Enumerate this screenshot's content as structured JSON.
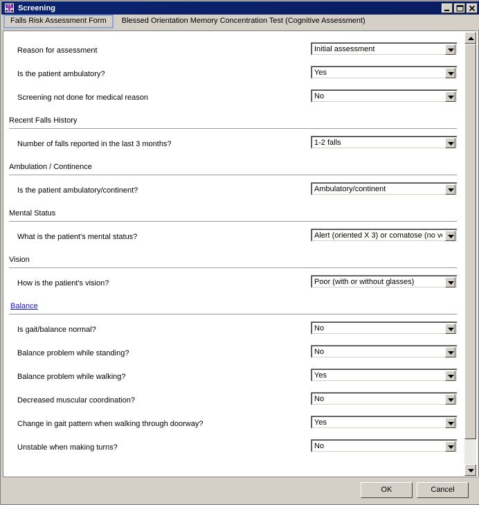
{
  "window": {
    "title": "Screening",
    "icon": "app-icon",
    "controls": [
      {
        "name": "minimize-button",
        "icon": "minimize-icon"
      },
      {
        "name": "maximize-button",
        "icon": "maximize-icon"
      },
      {
        "name": "close-button",
        "icon": "close-icon"
      }
    ]
  },
  "tabs": [
    {
      "label": "Falls Risk Assessment Form",
      "active": true
    },
    {
      "label": "Blessed Orientation Memory Concentration Test (Cognitive Assessment)",
      "active": false
    }
  ],
  "form": {
    "rows": [
      {
        "type": "field",
        "label": "Reason for assessment",
        "value": "Initial assessment",
        "name": "reason-for-assessment"
      },
      {
        "type": "field",
        "label": "Is the patient ambulatory?",
        "value": "Yes",
        "name": "is-patient-ambulatory"
      },
      {
        "type": "field",
        "label": "Screening not done for medical reason",
        "value": "No",
        "name": "screening-not-done-medical-reason"
      },
      {
        "type": "section",
        "label": "Recent Falls History",
        "link": false,
        "name": "section-recent-falls-history"
      },
      {
        "type": "field",
        "label": "Number of falls reported in the last 3 months?",
        "value": "1-2 falls",
        "name": "number-of-falls-last-3-months"
      },
      {
        "type": "section",
        "label": "Ambulation / Continence",
        "link": false,
        "name": "section-ambulation-continence"
      },
      {
        "type": "field",
        "label": "Is the patient ambulatory/continent?",
        "value": "Ambulatory/continent",
        "name": "is-patient-ambulatory-continent"
      },
      {
        "type": "section",
        "label": "Mental Status",
        "link": false,
        "name": "section-mental-status"
      },
      {
        "type": "field",
        "label": "What is the patient's mental status?",
        "value": "Alert (oriented X 3) or comatose (no volu",
        "name": "patient-mental-status"
      },
      {
        "type": "section",
        "label": "Vision",
        "link": false,
        "name": "section-vision"
      },
      {
        "type": "field",
        "label": "How is the patient's vision?",
        "value": "Poor (with or without glasses)",
        "name": "patient-vision"
      },
      {
        "type": "section",
        "label": "Balance",
        "link": true,
        "name": "section-balance"
      },
      {
        "type": "field",
        "label": "Is gait/balance normal?",
        "value": "No",
        "name": "is-gait-balance-normal"
      },
      {
        "type": "field",
        "label": "Balance problem while standing?",
        "value": "No",
        "name": "balance-problem-standing"
      },
      {
        "type": "field",
        "label": "Balance problem while walking?",
        "value": "Yes",
        "name": "balance-problem-walking"
      },
      {
        "type": "field",
        "label": "Decreased muscular coordination?",
        "value": "No",
        "name": "decreased-muscular-coordination"
      },
      {
        "type": "field",
        "label": "Change in gait pattern when walking through doorway?",
        "value": "Yes",
        "name": "change-gait-pattern-doorway"
      },
      {
        "type": "field",
        "label": "Unstable when making turns?",
        "value": "No",
        "name": "unstable-making-turns"
      }
    ]
  },
  "buttons": {
    "ok": "OK",
    "cancel": "Cancel"
  },
  "colors": {
    "titlebar": "#0a1f6e",
    "face": "#d4d0c8",
    "link": "#1111cc",
    "tab_active_border": "#8ea6d4"
  }
}
